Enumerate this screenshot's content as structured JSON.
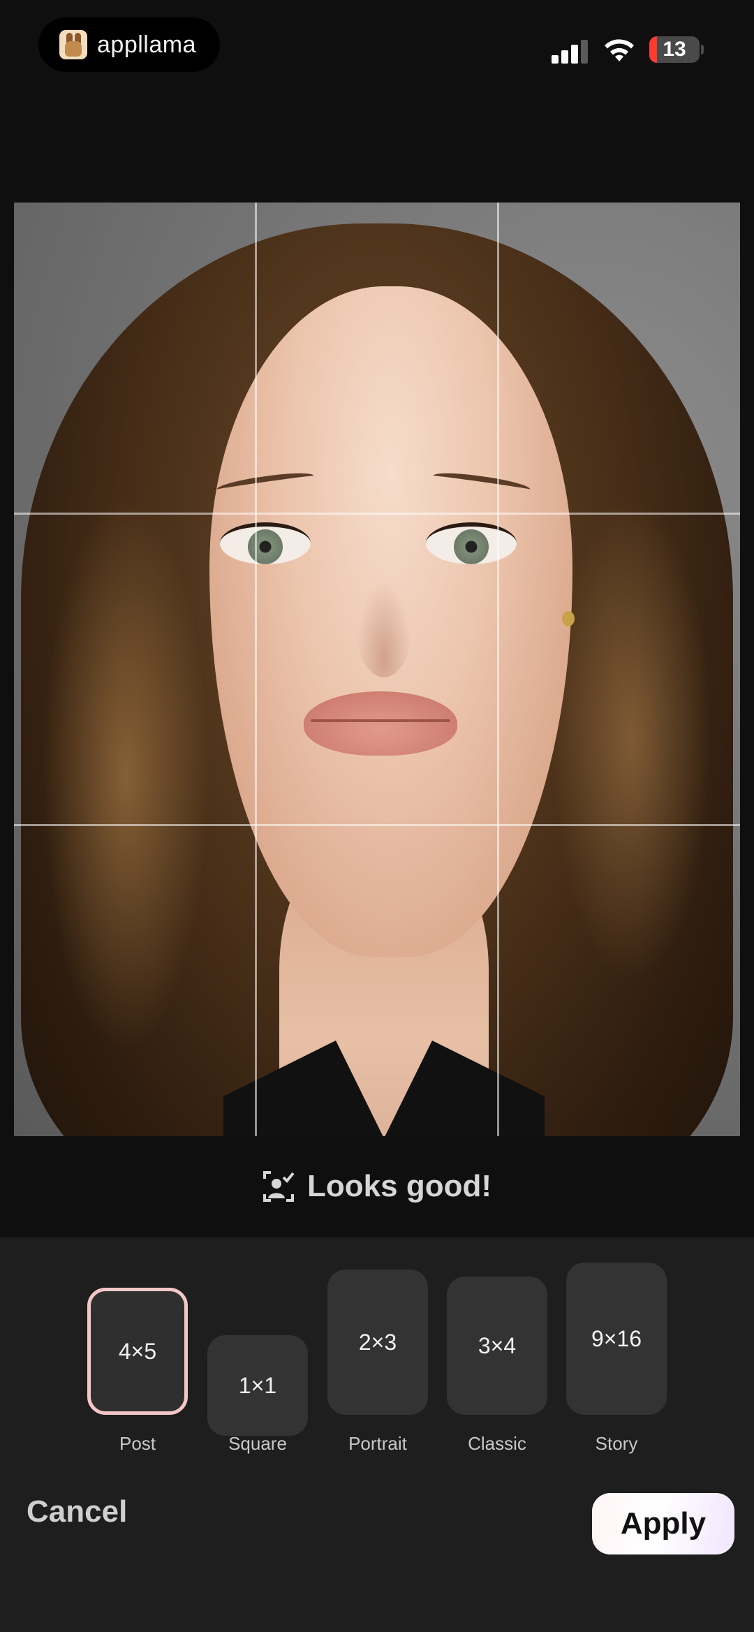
{
  "status_bar": {
    "app_name": "appllama",
    "battery": "13"
  },
  "photo": {
    "status_text": "Looks good!"
  },
  "aspect_ratios": [
    {
      "value": "4×5",
      "label": "Post",
      "selected": true
    },
    {
      "value": "1×1",
      "label": "Square",
      "selected": false
    },
    {
      "value": "2×3",
      "label": "Portrait",
      "selected": false
    },
    {
      "value": "3×4",
      "label": "Classic",
      "selected": false
    },
    {
      "value": "9×16",
      "label": "Story",
      "selected": false
    }
  ],
  "actions": {
    "cancel": "Cancel",
    "apply": "Apply"
  },
  "colors": {
    "selected_border": "#f4c6c8",
    "battery_low": "#ff3b30",
    "panel": "#1e1e1e"
  }
}
